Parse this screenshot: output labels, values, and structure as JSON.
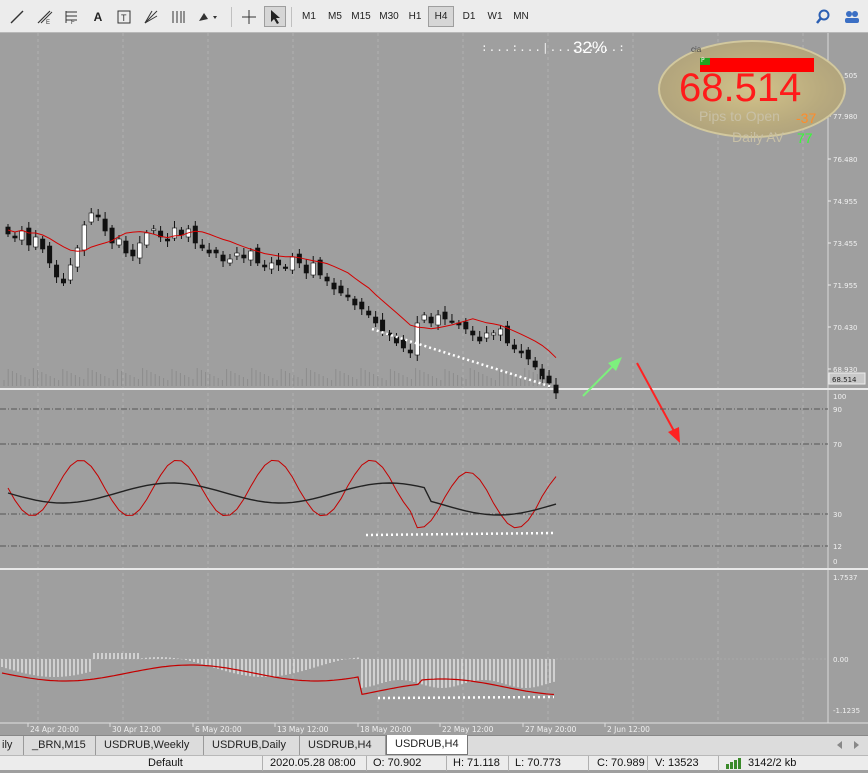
{
  "toolbar": {
    "tools": [
      "line-tool-icon",
      "fib-expansion-icon",
      "fib-retracement-icon",
      "text-icon",
      "text-label-icon",
      "fan-icon",
      "fib-lines-icon",
      "shapes-icon",
      "crosshair-icon",
      "cursor-icon"
    ],
    "timeframes": [
      "M1",
      "M5",
      "M15",
      "M30",
      "H1",
      "H4",
      "D1",
      "W1",
      "MN"
    ],
    "active_timeframe": "H4"
  },
  "chart": {
    "progress_dots": ":...:...|.....:...:",
    "progress_percent": "32%",
    "price_panel": {
      "price_axis": [
        "79.505",
        "77.980",
        "76.480",
        "74.955",
        "73.455",
        "71.955",
        "70.430",
        "68.930"
      ],
      "current_price_tag": "68.514"
    },
    "rsi_panel": {
      "levels": [
        "100",
        "90",
        "70",
        "30",
        "12",
        "0"
      ]
    },
    "macd_panel": {
      "levels": [
        "1.7537",
        "0.00",
        "-1.1235"
      ]
    },
    "time_axis": [
      "24 Apr 20:00",
      "30 Apr 12:00",
      "6 May 20:00",
      "13 May 12:00",
      "18 May 20:00",
      "22 May 12:00",
      "27 May 20:00",
      "2 Jun 12:00"
    ]
  },
  "info_widget": {
    "label": "cia",
    "flag": "P",
    "price": "68.514",
    "pips_label": "Pips to Open",
    "pips_value": "-37",
    "open_label": "Pips to Op",
    "daily_av_label": "Daily AV",
    "daily_av_value": "77",
    "colors": {
      "price": "#ff1a1a",
      "pips": "#ff8c2a",
      "daily_av": "#33ff33"
    }
  },
  "tabs": [
    "ily",
    "_BRN,M15",
    "USDRUB,Weekly",
    "USDRUB,Daily",
    "USDRUB,H4",
    "USDRUB,H4"
  ],
  "active_tab": 5,
  "status": {
    "profile": "Default",
    "datetime": "2020.05.28 08:00",
    "open": "O: 70.902",
    "high": "H: 71.118",
    "low": "L: 70.773",
    "close": "C: 70.989",
    "volume": "V: 13523",
    "traffic": "3142/2 kb"
  },
  "colors": {
    "chart_bg": "#9f9f9f",
    "ma": "#d40000",
    "up_arrow": "#7df07d",
    "down_arrow": "#ff2222"
  }
}
